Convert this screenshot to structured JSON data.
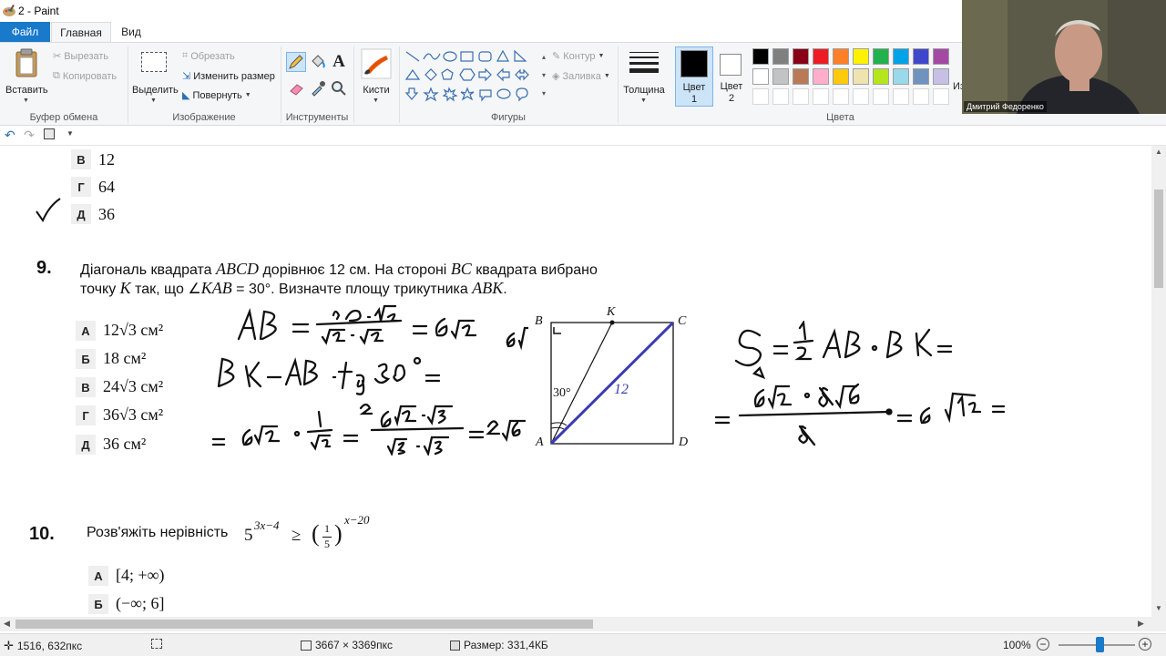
{
  "window": {
    "title": "2 - Paint"
  },
  "tabs": {
    "file": "Файл",
    "home": "Главная",
    "view": "Вид"
  },
  "clipboard": {
    "paste": "Вставить",
    "cut": "Вырезать",
    "copy": "Копировать",
    "group": "Буфер обмена"
  },
  "image": {
    "select": "Выделить",
    "crop": "Обрезать",
    "resize": "Изменить размер",
    "rotate": "Повернуть",
    "group": "Изображение"
  },
  "tools": {
    "group": "Инструменты"
  },
  "brushes": {
    "label": "Кисти"
  },
  "shapes": {
    "outline": "Контур",
    "fill": "Заливка",
    "group": "Фигуры"
  },
  "size": {
    "label": "Толщина"
  },
  "colors": {
    "color1_line1": "Цвет",
    "color1_line2": "1",
    "color2_line1": "Цвет",
    "color2_line2": "2",
    "group": "Цвета",
    "edit_truncated": "Из",
    "palette_row1": [
      "#000000",
      "#7f7f7f",
      "#880015",
      "#ed1c24",
      "#ff7f27",
      "#fff200",
      "#22b14c",
      "#00a2e8",
      "#3f48cc",
      "#a349a4"
    ],
    "palette_row2": [
      "#ffffff",
      "#c3c3c3",
      "#b97a57",
      "#ffaec9",
      "#ffc90e",
      "#efe4b0",
      "#b5e61d",
      "#99d9ea",
      "#7092be",
      "#c8bfe7"
    ]
  },
  "webcam": {
    "name": "Дмитрий Федоренко"
  },
  "canvas": {
    "prev_options": [
      {
        "letter": "В",
        "value": "12"
      },
      {
        "letter": "Г",
        "value": "64"
      },
      {
        "letter": "Д",
        "value": "36"
      }
    ],
    "q9": {
      "number": "9.",
      "line1_a": "Діагональ квадрата ",
      "line1_b": "ABCD",
      "line1_c": " дорівнює 12 см. На стороні ",
      "line1_d": "BC",
      "line1_e": " квадрата вибрано",
      "line2_a": "точку ",
      "line2_b": "K",
      "line2_c": " так, що ∠",
      "line2_d": "KAB",
      "line2_e": " = 30°. Визначте площу трикутника ",
      "line2_f": "ABK",
      "line2_g": ".",
      "options": [
        {
          "letter": "А",
          "value": "12√3 см²"
        },
        {
          "letter": "Б",
          "value": "18 см²"
        },
        {
          "letter": "В",
          "value": "24√3 см²"
        },
        {
          "letter": "Г",
          "value": "36√3 см²"
        },
        {
          "letter": "Д",
          "value": "36 см²"
        }
      ],
      "figure": {
        "B": "B",
        "C": "C",
        "A": "A",
        "D": "D",
        "K": "K",
        "angle": "30°",
        "diag": "12"
      }
    },
    "q10": {
      "number": "10.",
      "text": "Розв'яжіть нерівність",
      "base": "5",
      "exp": "3x−4",
      "rel": "≥",
      "frac_num": "1",
      "frac_den": "5",
      "exp2": "x−20",
      "options": [
        {
          "letter": "А",
          "value": "[4; +∞)"
        },
        {
          "letter": "Б",
          "value": "(−∞; 6]"
        }
      ]
    }
  },
  "status": {
    "cursor": "1516, 632пкс",
    "dimensions": "3667 × 3369пкс",
    "filesize": "Размер: 331,4КБ",
    "zoom": "100%"
  }
}
